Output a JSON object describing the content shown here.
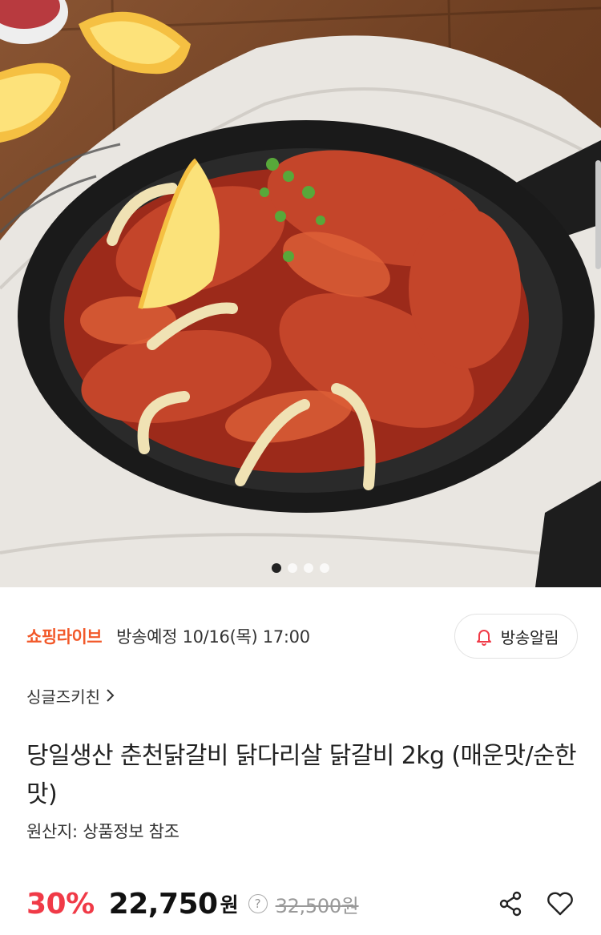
{
  "hero": {
    "image_icon": "food-photo-spicy-chicken-galbi",
    "pager_count": 4,
    "pager_active": 0
  },
  "broadcast": {
    "label": "쇼핑라이브",
    "schedule": "방송예정 10/16(목) 17:00",
    "alarm_button_label": "방송알림",
    "alarm_icon": "bell-icon",
    "label_color": "#f2592a",
    "alarm_icon_color": "#f03a47"
  },
  "store": {
    "name": "싱글즈키친",
    "icon": "chevron-right-icon"
  },
  "product": {
    "title": "당일생산 춘천닭갈비 닭다리살 닭갈비 2kg (매운맛/순한맛)",
    "origin": "원산지: 상품정보 참조"
  },
  "price": {
    "discount": "30%",
    "sale_price": "22,750",
    "currency": "원",
    "info_symbol": "?",
    "original_price": "32,500원",
    "discount_color": "#f03a47"
  },
  "actions": {
    "share_icon": "share-icon",
    "wishlist_icon": "heart-icon"
  }
}
